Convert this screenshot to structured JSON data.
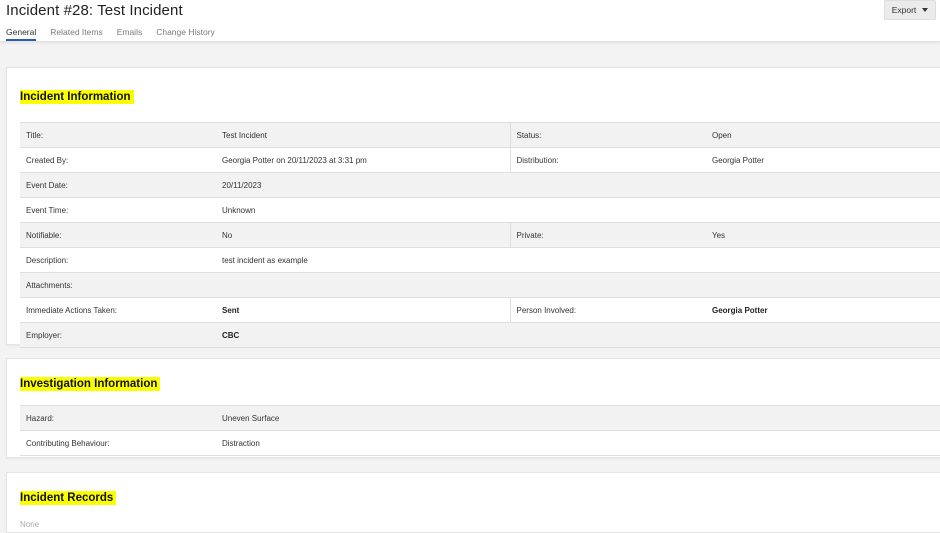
{
  "header": {
    "title": "Incident #28: Test Incident",
    "export_label": "Export",
    "tabs": [
      {
        "label": "General",
        "active": true
      },
      {
        "label": "Related Items",
        "active": false
      },
      {
        "label": "Emails",
        "active": false
      },
      {
        "label": "Change History",
        "active": false
      }
    ]
  },
  "incident_information": {
    "heading": "Incident Information",
    "rows": [
      {
        "label": "Title:",
        "value": "Test Incident",
        "label2": "Status:",
        "value2": "Open"
      },
      {
        "label": "Created By:",
        "value": "Georgia Potter on 20/11/2023 at 3:31 pm",
        "label2": "Distribution:",
        "value2": "Georgia Potter"
      },
      {
        "label": "Event Date:",
        "value": "20/11/2023",
        "label2": "",
        "value2": ""
      },
      {
        "label": "Event Time:",
        "value": "Unknown",
        "label2": "",
        "value2": ""
      },
      {
        "label": "Notifiable:",
        "value": "No",
        "label2": "Private:",
        "value2": "Yes"
      },
      {
        "label": "Description:",
        "value": "test incident as example",
        "label2": "",
        "value2": ""
      },
      {
        "label": "Attachments:",
        "value": "",
        "label2": "",
        "value2": ""
      },
      {
        "label": "Immediate Actions Taken:",
        "value": "Sent",
        "label2": "Person Involved:",
        "value2": "Georgia Potter"
      },
      {
        "label": "Employer:",
        "value": "CBC",
        "label2": "",
        "value2": ""
      }
    ]
  },
  "investigation_information": {
    "heading": "Investigation Information",
    "rows": [
      {
        "label": "Hazard:",
        "value": "Uneven Surface"
      },
      {
        "label": "Contributing Behaviour:",
        "value": "Distraction"
      }
    ]
  },
  "incident_records": {
    "heading": "Incident Records",
    "empty_text": "None"
  },
  "colors": {
    "highlight": "#fbff00",
    "active_tab": "#2b5ea8",
    "row_shade": "#f2f2f2",
    "page_bg": "#f3f3f3"
  }
}
